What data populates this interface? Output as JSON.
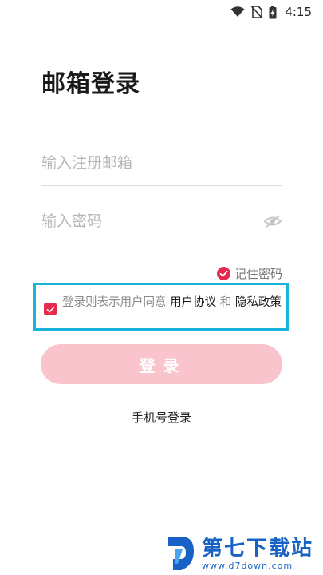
{
  "status_bar": {
    "time": "4:15"
  },
  "login": {
    "title": "邮箱登录",
    "email_placeholder": "输入注册邮箱",
    "password_placeholder": "输入密码",
    "remember_label": "记住密码",
    "agreement_prefix": "登录则表示用户同意 ",
    "user_agreement_link": "用户协议",
    "and_text": " 和 ",
    "privacy_policy_link": "隐私政策",
    "submit_label": "登录",
    "alt_login_label": "手机号登录"
  },
  "watermark": {
    "name": "第七下载站",
    "url": "www.d7down.com"
  },
  "colors": {
    "accent_red": "#e6294d",
    "button_pink": "#f9c4cb",
    "highlight_box": "#19b3dc",
    "watermark_blue": "#1762c4"
  }
}
